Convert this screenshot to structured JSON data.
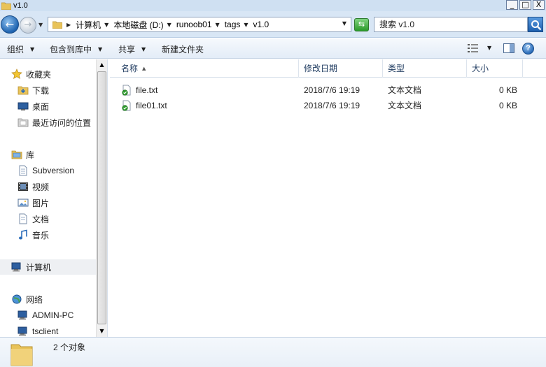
{
  "window": {
    "title": "v1.0",
    "controls": {
      "minimize": "_",
      "maximize": "□",
      "close": "X"
    }
  },
  "address": {
    "crumbs": [
      "计算机",
      "本地磁盘 (D:)",
      "runoob01",
      "tags",
      "v1.0"
    ],
    "search_placeholder": "搜索 v1.0"
  },
  "toolbar": {
    "organize": "组织",
    "include_in_library": "包含到库中",
    "share": "共享",
    "new_folder": "新建文件夹"
  },
  "nav": {
    "favorites": {
      "label": "收藏夹",
      "items": [
        "下载",
        "桌面",
        "最近访问的位置"
      ]
    },
    "libraries": {
      "label": "库",
      "items": [
        "Subversion",
        "视频",
        "图片",
        "文档",
        "音乐"
      ]
    },
    "computer": {
      "label": "计算机"
    },
    "network": {
      "label": "网络",
      "items": [
        "ADMIN-PC",
        "tsclient"
      ]
    }
  },
  "columns": {
    "name": "名称",
    "modified": "修改日期",
    "type": "类型",
    "size": "大小"
  },
  "files": [
    {
      "name": "file.txt",
      "modified": "2018/7/6 19:19",
      "type": "文本文档",
      "size": "0 KB"
    },
    {
      "name": "file01.txt",
      "modified": "2018/7/6 19:19",
      "type": "文本文档",
      "size": "0 KB"
    }
  ],
  "status": {
    "item_count": "2 个对象"
  },
  "colors": {
    "accent": "#1e63b0",
    "titlebar": "#cfe0f2",
    "folder": "#e8c35a",
    "svn_ok": "#2e9a2e"
  }
}
